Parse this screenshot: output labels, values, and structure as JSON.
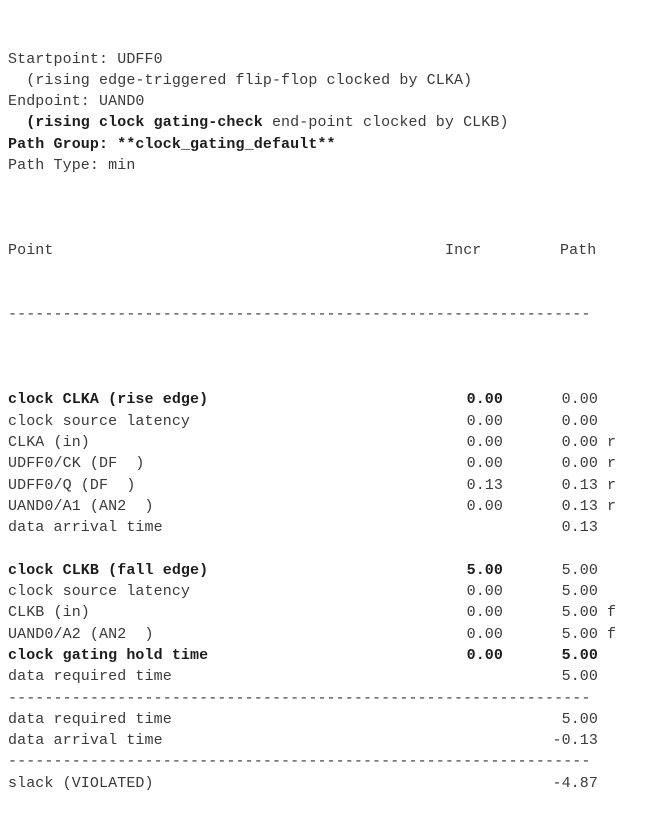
{
  "report": {
    "header_lines": [
      {
        "segments": [
          {
            "text": "Startpoint: UDFF0",
            "bold": false
          }
        ]
      },
      {
        "segments": [
          {
            "text": "  (rising edge-triggered flip-flop clocked by CLKA)",
            "bold": false
          }
        ]
      },
      {
        "segments": [
          {
            "text": "Endpoint: UAND0",
            "bold": false
          }
        ]
      },
      {
        "segments": [
          {
            "text": "  ",
            "bold": false
          },
          {
            "text": "(rising clock gating-check",
            "bold": true
          },
          {
            "text": " end-point clocked by CLKB)",
            "bold": false
          }
        ]
      },
      {
        "segments": [
          {
            "text": "Path Group: **clock_gating_default**",
            "bold": true
          }
        ]
      },
      {
        "segments": [
          {
            "text": "Path Type: min",
            "bold": false
          }
        ]
      }
    ],
    "column_headers": {
      "point": "Point",
      "incr": "Incr",
      "path": "Path"
    },
    "divider": "----------------------------------------------------------------",
    "rows": [
      {
        "kind": "row",
        "point": "clock CLKA (rise edge)",
        "incr": "0.00",
        "path": "0.00",
        "flag": "",
        "bold_point": true,
        "bold_incr": true,
        "bold_path": false
      },
      {
        "kind": "row",
        "point": "clock source latency",
        "incr": "0.00",
        "path": "0.00",
        "flag": "",
        "bold_point": false,
        "bold_incr": false,
        "bold_path": false
      },
      {
        "kind": "row",
        "point": "CLKA (in)",
        "incr": "0.00",
        "path": "0.00",
        "flag": "r",
        "bold_point": false,
        "bold_incr": false,
        "bold_path": false
      },
      {
        "kind": "row",
        "point": "UDFF0/CK (DF  )",
        "incr": "0.00",
        "path": "0.00",
        "flag": "r",
        "bold_point": false,
        "bold_incr": false,
        "bold_path": false
      },
      {
        "kind": "row",
        "point": "UDFF0/Q (DF  )",
        "incr": "0.13",
        "path": "0.13",
        "flag": "r",
        "bold_point": false,
        "bold_incr": false,
        "bold_path": false
      },
      {
        "kind": "row",
        "point": "UAND0/A1 (AN2  )",
        "incr": "0.00",
        "path": "0.13",
        "flag": "r",
        "bold_point": false,
        "bold_incr": false,
        "bold_path": false
      },
      {
        "kind": "row",
        "point": "data arrival time",
        "incr": "",
        "path": "0.13",
        "flag": "",
        "bold_point": false,
        "bold_incr": false,
        "bold_path": false
      },
      {
        "kind": "spacer"
      },
      {
        "kind": "row",
        "point": "clock CLKB (fall edge)",
        "incr": "5.00",
        "path": "5.00",
        "flag": "",
        "bold_point": true,
        "bold_incr": true,
        "bold_path": false
      },
      {
        "kind": "row",
        "point": "clock source latency",
        "incr": "0.00",
        "path": "5.00",
        "flag": "",
        "bold_point": false,
        "bold_incr": false,
        "bold_path": false
      },
      {
        "kind": "row",
        "point": "CLKB (in)",
        "incr": "0.00",
        "path": "5.00",
        "flag": "f",
        "bold_point": false,
        "bold_incr": false,
        "bold_path": false
      },
      {
        "kind": "row",
        "point": "UAND0/A2 (AN2  )",
        "incr": "0.00",
        "path": "5.00",
        "flag": "f",
        "bold_point": false,
        "bold_incr": false,
        "bold_path": false
      },
      {
        "kind": "row",
        "point": "clock gating hold time",
        "incr": "0.00",
        "path": "5.00",
        "flag": "",
        "bold_point": true,
        "bold_incr": true,
        "bold_path": true
      },
      {
        "kind": "row",
        "point": "data required time",
        "incr": "",
        "path": "5.00",
        "flag": "",
        "bold_point": false,
        "bold_incr": false,
        "bold_path": false
      },
      {
        "kind": "divider"
      },
      {
        "kind": "row",
        "point": "data required time",
        "incr": "",
        "path": "5.00",
        "flag": "",
        "bold_point": false,
        "bold_incr": false,
        "bold_path": false
      },
      {
        "kind": "row",
        "point": "data arrival time",
        "incr": "",
        "path": "-0.13",
        "flag": "",
        "bold_point": false,
        "bold_incr": false,
        "bold_path": false
      },
      {
        "kind": "divider"
      },
      {
        "kind": "row",
        "point": "slack (VIOLATED)",
        "incr": "",
        "path": "-4.87",
        "flag": "",
        "bold_point": false,
        "bold_incr": false,
        "bold_path": false
      }
    ]
  }
}
